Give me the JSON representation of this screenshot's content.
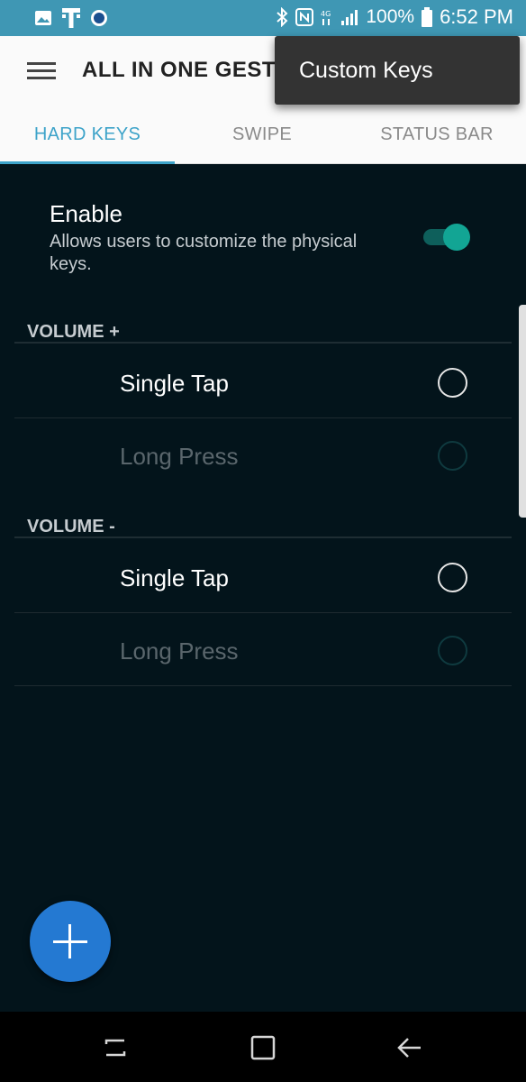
{
  "status_bar": {
    "battery": "100%",
    "time": "6:52 PM",
    "icons": [
      "gallery-icon",
      "tmobile-icon",
      "app-notification-icon",
      "bluetooth-icon",
      "nfc-icon",
      "lte-icon",
      "signal-icon",
      "battery-icon"
    ]
  },
  "toolbar": {
    "title": "ALL IN ONE GESTUR",
    "menu_icon": "hamburger-menu-icon"
  },
  "popup_menu": {
    "items": [
      {
        "label": "Custom Keys"
      }
    ]
  },
  "tabs": [
    {
      "label": "HARD KEYS",
      "active": true
    },
    {
      "label": "SWIPE",
      "active": false
    },
    {
      "label": "STATUS BAR",
      "active": false
    }
  ],
  "enable": {
    "title": "Enable",
    "description": "Allows users to customize the physical keys.",
    "on": true
  },
  "sections": [
    {
      "header": "VOLUME +",
      "rows": [
        {
          "label": "Single Tap",
          "enabled": true
        },
        {
          "label": "Long Press",
          "enabled": false
        }
      ]
    },
    {
      "header": "VOLUME -",
      "rows": [
        {
          "label": "Single Tap",
          "enabled": true
        },
        {
          "label": "Long Press",
          "enabled": false
        }
      ]
    }
  ],
  "fab": {
    "icon": "plus-icon"
  },
  "nav_bar": {
    "icons": [
      "recents-icon",
      "home-icon",
      "back-icon"
    ]
  },
  "colors": {
    "status_bar": "#3f97b4",
    "accent": "#3da3c9",
    "toggle_on": "#12a594",
    "background": "#03141b",
    "fab": "#2479d2"
  }
}
